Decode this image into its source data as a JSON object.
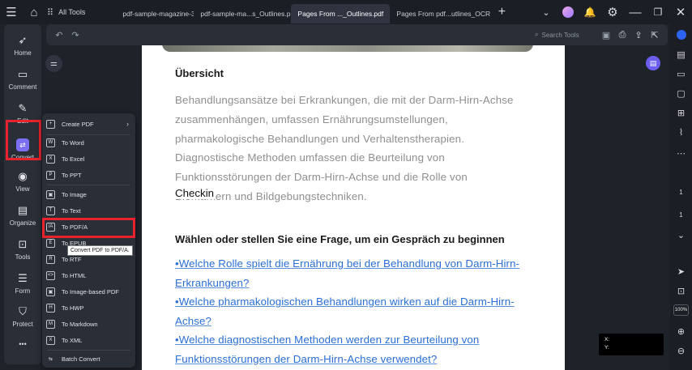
{
  "titlebar": {
    "all_tools": "All Tools",
    "tabs": [
      {
        "label": "pdf-sample-magazine-3.pdf",
        "active": false
      },
      {
        "label": "pdf-sample-ma...s_Outlines.pdf *",
        "active": false
      },
      {
        "label": "Pages  From ..._Outlines.pdf",
        "active": true
      },
      {
        "label": "Pages  From pdf...utlines_OCR.pdf",
        "active": false
      }
    ],
    "add_tab": "+"
  },
  "leftbar": {
    "items": [
      {
        "label": "Home",
        "icon": "rocket-icon"
      },
      {
        "label": "Comment",
        "icon": "comment-icon"
      },
      {
        "label": "Edit",
        "icon": "edit-icon"
      },
      {
        "label": "Convert",
        "icon": "convert-icon"
      },
      {
        "label": "View",
        "icon": "eye-icon"
      },
      {
        "label": "Organize",
        "icon": "organize-icon"
      },
      {
        "label": "Tools",
        "icon": "toolbox-icon"
      },
      {
        "label": "Form",
        "icon": "form-icon"
      },
      {
        "label": "Protect",
        "icon": "shield-icon"
      }
    ],
    "more": "•••"
  },
  "toolbar": {
    "search_tools": "Search Tools"
  },
  "convert_menu": {
    "items": [
      {
        "label": "Create PDF",
        "icon": "+"
      },
      {
        "label": "To Word",
        "icon": "W"
      },
      {
        "label": "To Excel",
        "icon": "X"
      },
      {
        "label": "To PPT",
        "icon": "P"
      },
      {
        "label": "To Image",
        "icon": "▣"
      },
      {
        "label": "To Text",
        "icon": "T"
      },
      {
        "label": "To PDF/A",
        "icon": "/A"
      },
      {
        "label": "To EPUB",
        "icon": "E"
      },
      {
        "label": "To RTF",
        "icon": "R"
      },
      {
        "label": "To HTML",
        "icon": "<>"
      },
      {
        "label": "To Image-based PDF",
        "icon": "▣"
      },
      {
        "label": "To HWP",
        "icon": "H"
      },
      {
        "label": "To Markdown",
        "icon": "M"
      },
      {
        "label": "To XML",
        "icon": "X"
      },
      {
        "label": "Batch Convert",
        "icon": "⇆"
      }
    ],
    "tooltip": "Convert PDF to PDF/A."
  },
  "document": {
    "heading1": "Übersicht",
    "paragraph_lines": [
      "Behandlungsansätze bei Erkrankungen, die mit der Darm-Hirn-Achse",
      "zusammenhängen, umfassen Ernährungsumstellungen,",
      "pharmakologische Behandlungen und Verhaltenstherapien.",
      "Diagnostische Methoden umfassen die Beurteilung von",
      "Funktionsstörungen der Darm-Hirn-Achse und die Rolle von",
      "Biomarkern und Bildgebungstechniken."
    ],
    "overlay_text": "Checkin",
    "heading2": "Wählen oder stellen Sie eine Frage, um ein Gespräch zu beginnen",
    "questions": [
      "•Welche Rolle spielt die Ernährung bei der Behandlung von Darm-Hirn-",
      "Erkrankungen?",
      "•Welche pharmakologischen Behandlungen wirken auf die Darm-Hirn-",
      "Achse?",
      "•Welche diagnostischen Methoden werden zur Beurteilung von",
      "Funktionsstörungen der Darm-Hirn-Achse verwendet?"
    ]
  },
  "rightbar": {
    "page_current": "1",
    "page_total": "1",
    "zoom": "100%"
  },
  "coords": {
    "x_label": "X:",
    "y_label": "Y:"
  },
  "colors": {
    "accent": "#7c6ef2",
    "highlight_border": "#e8232f",
    "link": "#2a6fd6"
  }
}
